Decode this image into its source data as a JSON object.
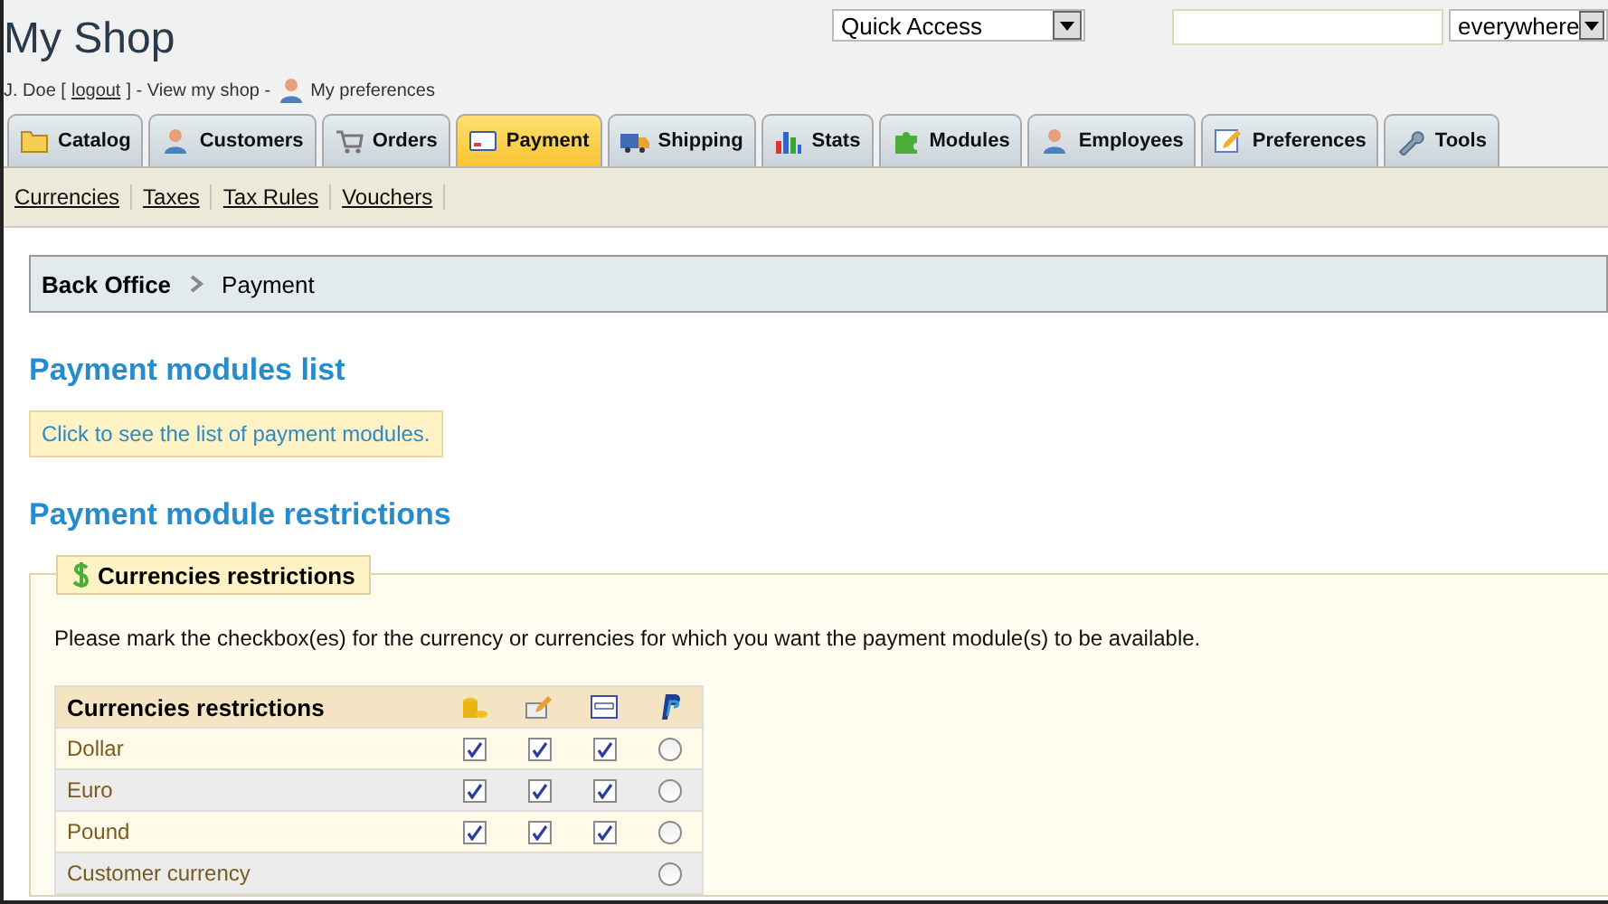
{
  "header": {
    "title": "My Shop",
    "user": "J. Doe [",
    "logout": "logout",
    "after_logout": "] - View my shop -",
    "preferences": "My preferences",
    "quick_access": "Quick Access",
    "search_scope": "everywhere"
  },
  "tabs": [
    {
      "label": "Catalog",
      "selected": false
    },
    {
      "label": "Customers",
      "selected": false
    },
    {
      "label": "Orders",
      "selected": false
    },
    {
      "label": "Payment",
      "selected": true
    },
    {
      "label": "Shipping",
      "selected": false
    },
    {
      "label": "Stats",
      "selected": false
    },
    {
      "label": "Modules",
      "selected": false
    },
    {
      "label": "Employees",
      "selected": false
    },
    {
      "label": "Preferences",
      "selected": false
    },
    {
      "label": "Tools",
      "selected": false
    }
  ],
  "subtabs": [
    "Currencies",
    "Taxes",
    "Tax Rules",
    "Vouchers"
  ],
  "breadcrumb": [
    "Back Office",
    "Payment"
  ],
  "modules_heading": "Payment modules list",
  "modules_notice": "Click to see the list of payment modules.",
  "restrictions_heading": "Payment module restrictions",
  "fieldset": {
    "legend": "Currencies restrictions",
    "description": "Please mark the checkbox(es) for the currency or currencies for which you want the payment module(s) to be available.",
    "table": {
      "heading": "Currencies restrictions",
      "rows": [
        {
          "name": "Dollar",
          "cells": [
            {
              "kind": "checkbox",
              "checked": true
            },
            {
              "kind": "checkbox",
              "checked": true
            },
            {
              "kind": "checkbox",
              "checked": true
            },
            {
              "kind": "radio",
              "checked": false
            }
          ]
        },
        {
          "name": "Euro",
          "cells": [
            {
              "kind": "checkbox",
              "checked": true
            },
            {
              "kind": "checkbox",
              "checked": true
            },
            {
              "kind": "checkbox",
              "checked": true
            },
            {
              "kind": "radio",
              "checked": false
            }
          ]
        },
        {
          "name": "Pound",
          "cells": [
            {
              "kind": "checkbox",
              "checked": true
            },
            {
              "kind": "checkbox",
              "checked": true
            },
            {
              "kind": "checkbox",
              "checked": true
            },
            {
              "kind": "radio",
              "checked": false
            }
          ]
        },
        {
          "name": "Customer currency",
          "cells": [
            {
              "kind": "none"
            },
            {
              "kind": "none"
            },
            {
              "kind": "none"
            },
            {
              "kind": "radio",
              "checked": false
            }
          ]
        }
      ]
    }
  }
}
